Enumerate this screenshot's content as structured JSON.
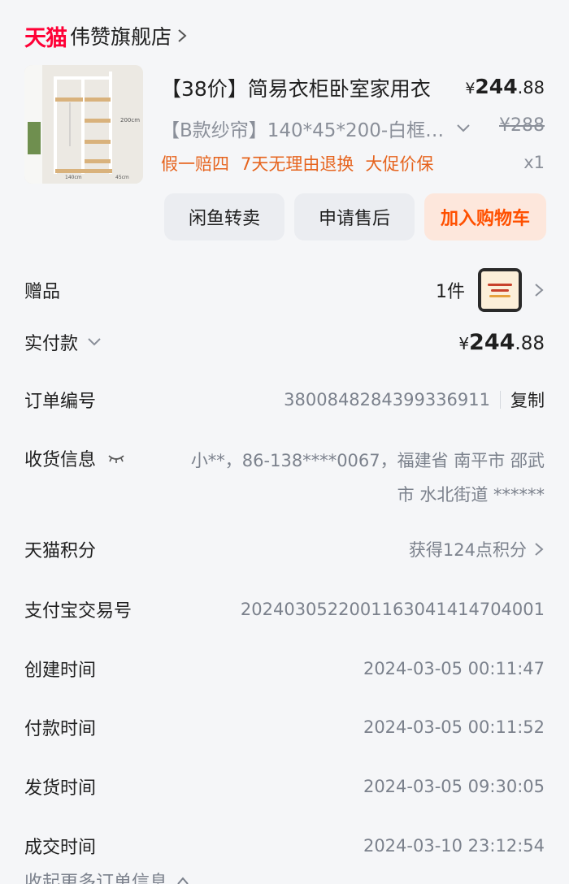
{
  "store": {
    "brand": "天猫",
    "name": "伟赞旗舰店"
  },
  "product": {
    "title": "【38价】简易衣柜卧室家用衣",
    "price": {
      "currency": "¥",
      "int": "244",
      "dec": ".88"
    },
    "sku": "【B款纱帘】140*45*200-白框…",
    "original_price": "¥288",
    "tags": [
      "假一赔四",
      "7天无理由退换",
      "大促价保"
    ],
    "quantity": "x1",
    "image_labels": {
      "height": "200cm",
      "width": "140cm",
      "depth": "45cm"
    }
  },
  "actions": {
    "resell": "闲鱼转卖",
    "after_sales": "申请售后",
    "add_cart": "加入购物车"
  },
  "details": {
    "gift_label": "赠品",
    "gift_count": "1件",
    "paid_label": "实付款",
    "paid": {
      "currency": "¥",
      "int": "244",
      "dec": ".88"
    },
    "order_no_label": "订单编号",
    "order_no": "3800848284399336911",
    "copy": "复制",
    "shipping_label": "收货信息",
    "shipping_value": "小**，86-138****0067，福建省 南平市 邵武市 水北街道 ******",
    "points_label": "天猫积分",
    "points_value": "获得124点积分",
    "alipay_label": "支付宝交易号",
    "alipay_value": "2024030522001163041414704001",
    "created_label": "创建时间",
    "created_value": "2024-03-05 00:11:47",
    "paid_time_label": "付款时间",
    "paid_time_value": "2024-03-05 00:11:52",
    "shipped_label": "发货时间",
    "shipped_value": "2024-03-05 09:30:05",
    "closed_label": "成交时间",
    "closed_value": "2024-03-10 23:12:54",
    "collapse": "收起更多订单信息"
  },
  "colors": {
    "brand_red": "#ff0036",
    "accent_orange": "#ff5000",
    "tag_orange": "#e6641e",
    "muted": "#7b818c"
  }
}
